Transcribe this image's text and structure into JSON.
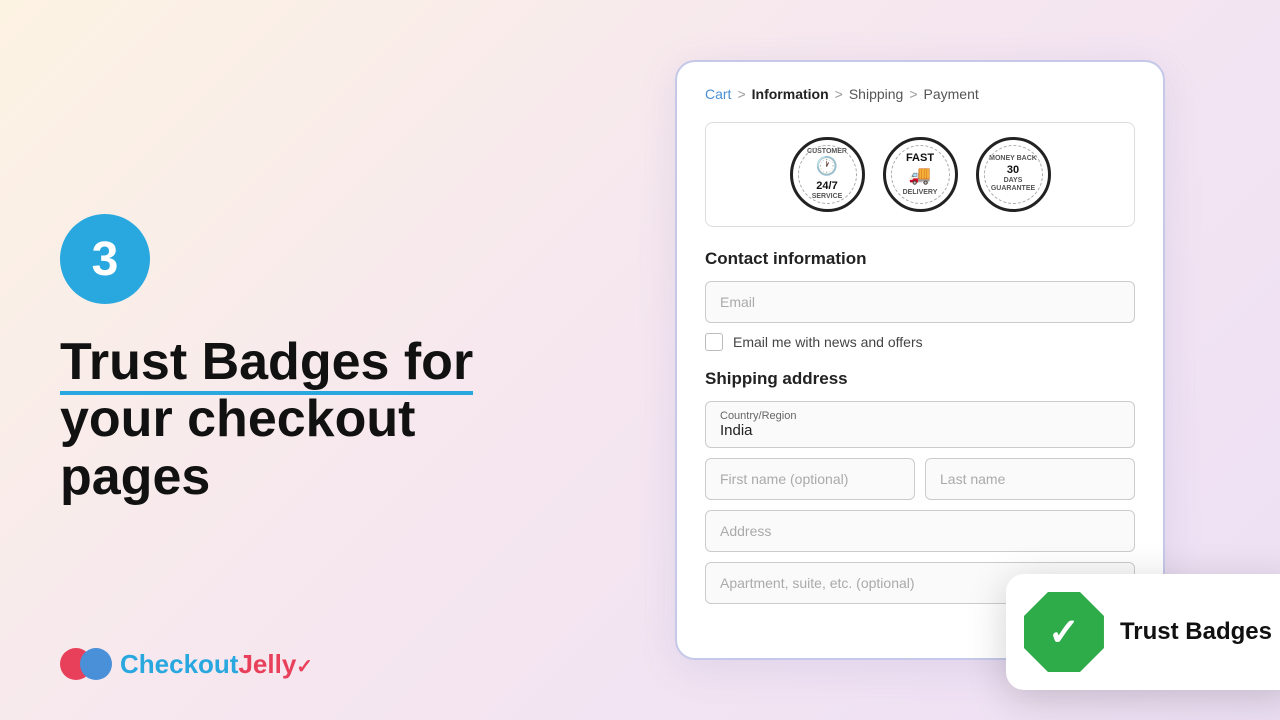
{
  "left": {
    "step_number": "3",
    "title_line1": "Trust Badges for",
    "title_line2": "your checkout",
    "title_line3": "pages",
    "underline_word": "Trust Badges for"
  },
  "logo": {
    "checkout_text": "Checkout",
    "jelly_text": "Jelly",
    "mark": "✓"
  },
  "checkout": {
    "breadcrumb": {
      "cart": "Cart",
      "sep1": ">",
      "information": "Information",
      "sep2": ">",
      "shipping": "Shipping",
      "sep3": ">",
      "payment": "Payment"
    },
    "trust_stamps": [
      {
        "icon": "🕐",
        "main": "24/7",
        "top": "CUSTOMER",
        "bottom": "SERVICE"
      },
      {
        "icon": "🚚",
        "main": "FAST",
        "top": "",
        "bottom": "DELIVERY"
      },
      {
        "icon": "30",
        "main": "DAYS",
        "top": "MONEY BACK",
        "bottom": "GUARANTEE"
      }
    ],
    "contact_section": {
      "title": "Contact information",
      "email_placeholder": "Email",
      "checkbox_label": "Email me with news and offers"
    },
    "shipping_section": {
      "title": "Shipping address",
      "country_label": "Country/Region",
      "country_value": "India",
      "first_name_placeholder": "First name (optional)",
      "last_name_placeholder": "Last name",
      "address_placeholder": "Address",
      "apt_placeholder": "Apartment, suite, etc. (optional)"
    }
  },
  "trust_badge_card": {
    "label": "Trust Badges"
  }
}
